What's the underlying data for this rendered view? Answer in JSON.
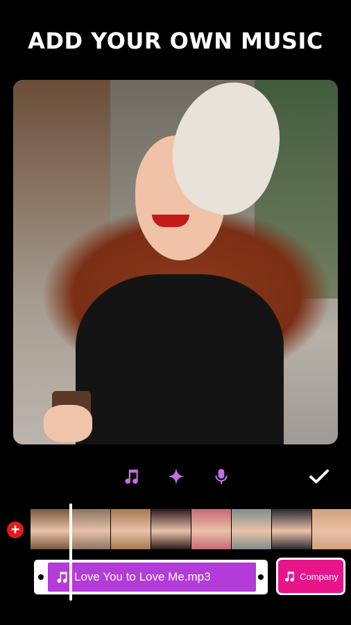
{
  "header": {
    "title": "ADD YOUR OWN MUSIC"
  },
  "toolbar": {
    "icons": [
      "music-note-icon",
      "sparkle-icon",
      "microphone-icon",
      "checkmark-icon"
    ],
    "accent_color": "#c56ee8",
    "check_color": "#ffffff"
  },
  "timeline": {
    "add_button_symbol": "+",
    "frame_colors": [
      "#7a5840",
      "#8a7462",
      "#a47a52",
      "#2e1a1e",
      "#c86878",
      "#7e8e8e",
      "#2a2a32",
      "#d2a07c"
    ],
    "playhead_color": "#ffffff"
  },
  "music_track": {
    "file_name": "Love You to Love Me.mp3",
    "track_color": "#b33bd9"
  },
  "company_track": {
    "label": "Company",
    "color": "#e8158a"
  }
}
